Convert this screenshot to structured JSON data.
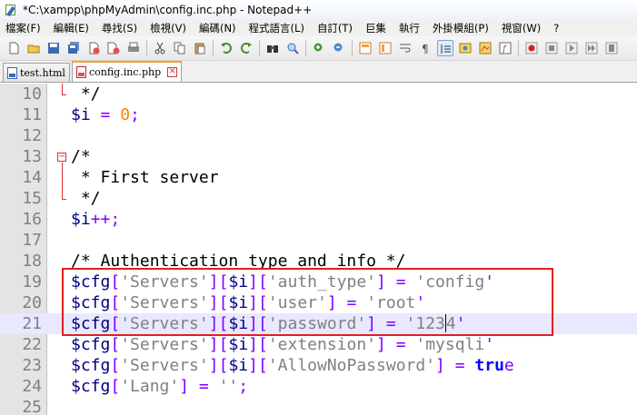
{
  "window": {
    "title": "*C:\\xampp\\phpMyAdmin\\config.inc.php - Notepad++"
  },
  "menu": [
    "檔案(F)",
    "編輯(E)",
    "尋找(S)",
    "檢視(V)",
    "編碼(N)",
    "程式語言(L)",
    "自訂(T)",
    "巨集",
    "執行",
    "外掛模組(P)",
    "視窗(W)",
    "?"
  ],
  "toolbar": {
    "icons": [
      "new-file-icon",
      "open-file-icon",
      "save-icon",
      "save-all-icon",
      "close-icon",
      "close-all-icon",
      "print-icon",
      "cut-icon",
      "copy-icon",
      "paste-icon",
      "undo-icon",
      "redo-icon",
      "find-icon",
      "replace-icon",
      "zoom-in-icon",
      "zoom-out-icon",
      "sync-vertical-icon",
      "sync-horizontal-icon",
      "word-wrap-icon",
      "show-all-chars-icon",
      "indent-guide-icon",
      "user-language-icon",
      "doc-map-icon",
      "function-list-icon",
      "record-macro-icon",
      "stop-macro-icon",
      "play-macro-icon",
      "play-multiple-icon",
      "save-macro-icon"
    ]
  },
  "tabs": [
    {
      "label": "test.html",
      "active": false
    },
    {
      "label": "config.inc.php",
      "active": true
    }
  ],
  "editor": {
    "lines": [
      {
        "num": "10",
        "text": " */"
      },
      {
        "num": "11",
        "text": "$i = 0;"
      },
      {
        "num": "12",
        "text": ""
      },
      {
        "num": "13",
        "text": "/*"
      },
      {
        "num": "14",
        "text": " * First server"
      },
      {
        "num": "15",
        "text": " */"
      },
      {
        "num": "16",
        "text": "$i++;"
      },
      {
        "num": "17",
        "text": ""
      },
      {
        "num": "18",
        "text": "/* Authentication type and info */"
      },
      {
        "num": "19",
        "text": "$cfg['Servers'][$i]['auth_type'] = 'config';"
      },
      {
        "num": "20",
        "text": "$cfg['Servers'][$i]['user'] = 'root';"
      },
      {
        "num": "21",
        "text": "$cfg['Servers'][$i]['password'] = '1234';"
      },
      {
        "num": "22",
        "text": "$cfg['Servers'][$i]['extension'] = 'mysqli';"
      },
      {
        "num": "23",
        "text": "$cfg['Servers'][$i]['AllowNoPassword'] = true;"
      },
      {
        "num": "24",
        "text": "$cfg['Lang'] = '';"
      },
      {
        "num": "25",
        "text": ""
      }
    ],
    "current_line": "21"
  },
  "colors": {
    "comment": "#008000",
    "variable": "#000080",
    "operator": "#8000ff",
    "number": "#ff8000",
    "string": "#808080",
    "keyword": "#0000ff",
    "current_line_bg": "#e8e8ff",
    "annotation_box": "#e02020"
  }
}
